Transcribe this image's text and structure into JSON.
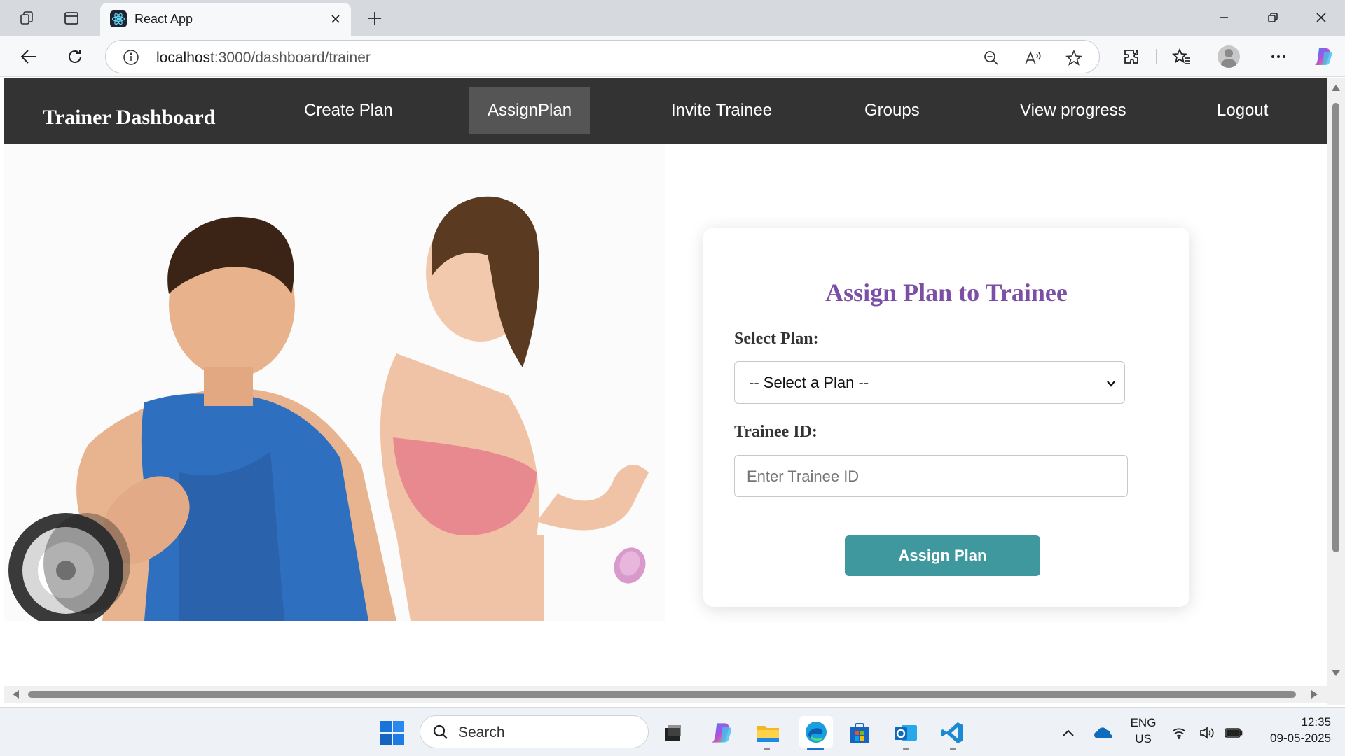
{
  "browser": {
    "tab_title": "React App",
    "url_host": "localhost",
    "url_rest": ":3000/dashboard/trainer"
  },
  "app": {
    "brand": "Trainer Dashboard",
    "nav": [
      {
        "label": "Create Plan"
      },
      {
        "label": "AssignPlan"
      },
      {
        "label": "Invite Trainee"
      },
      {
        "label": "Groups"
      },
      {
        "label": "View progress"
      },
      {
        "label": "Logout"
      }
    ],
    "active_nav": "AssignPlan"
  },
  "form": {
    "title": "Assign Plan to Trainee",
    "plan_label": "Select Plan:",
    "plan_selected": "-- Select a Plan --",
    "trainee_label": "Trainee ID:",
    "trainee_placeholder": "Enter Trainee ID",
    "submit_label": "Assign Plan"
  },
  "taskbar": {
    "search_label": "Search",
    "lang_line1": "ENG",
    "lang_line2": "US",
    "time": "12:35",
    "date": "09-05-2025"
  },
  "colors": {
    "nav_bg": "#333333",
    "nav_active": "#555555",
    "title_purple": "#7b4fa6",
    "button_teal": "#3e989e"
  }
}
